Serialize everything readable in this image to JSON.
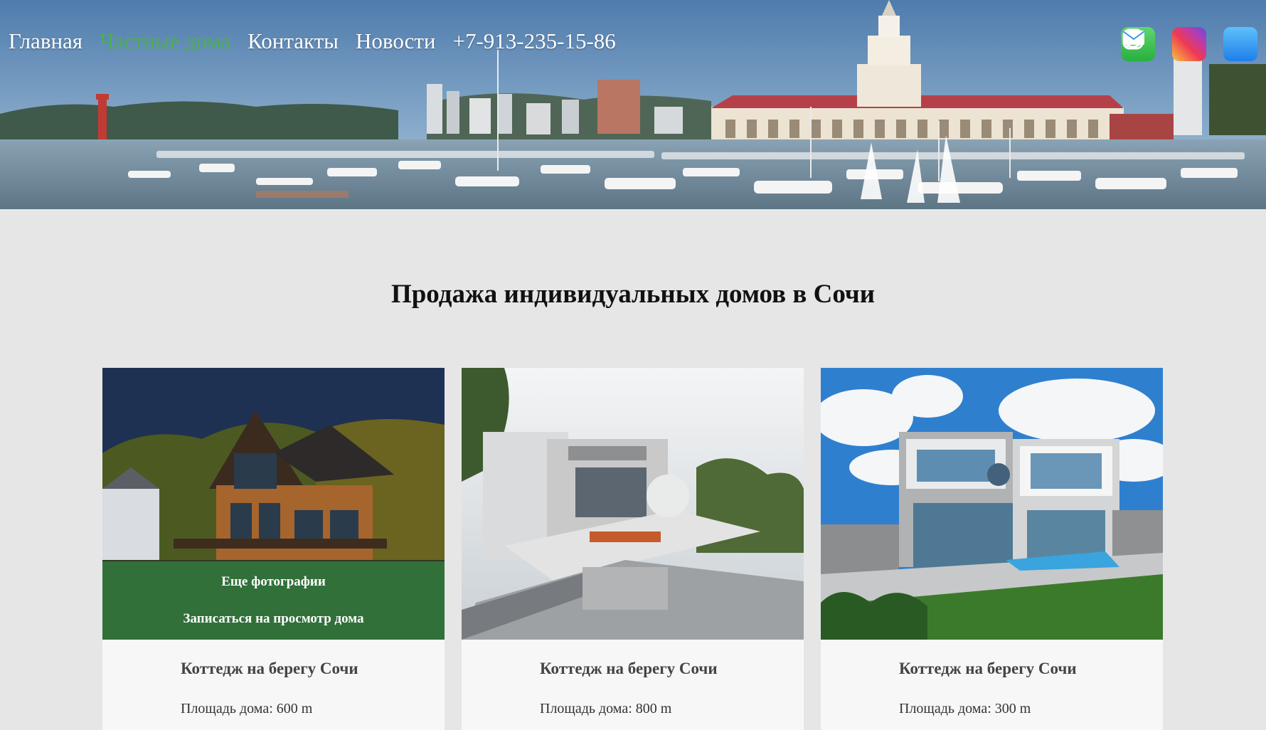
{
  "nav": {
    "items": [
      {
        "label": "Главная",
        "active": false
      },
      {
        "label": "Частные дома",
        "active": true
      },
      {
        "label": "Контакты",
        "active": false
      },
      {
        "label": "Новости",
        "active": false
      },
      {
        "label": "+7-913-235-15-86",
        "active": false
      }
    ],
    "active_color": "#4caf50"
  },
  "socials": [
    {
      "icon": "whatsapp-icon"
    },
    {
      "icon": "instagram-icon"
    },
    {
      "icon": "mail-icon"
    }
  ],
  "main": {
    "title": "Продажа индивидуальных домов в Сочи",
    "cards": [
      {
        "title": "Коттедж на берегу Сочи",
        "area_label": "Площадь дома: 600 m",
        "overlay": {
          "photos_label": "Еще фотографии",
          "booking_label": "Записаться на просмотр дома"
        }
      },
      {
        "title": "Коттедж на берегу Сочи",
        "area_label": "Площадь дома: 800 m"
      },
      {
        "title": "Коттедж на берегу Сочи",
        "area_label": "Площадь дома: 300 m"
      }
    ]
  }
}
